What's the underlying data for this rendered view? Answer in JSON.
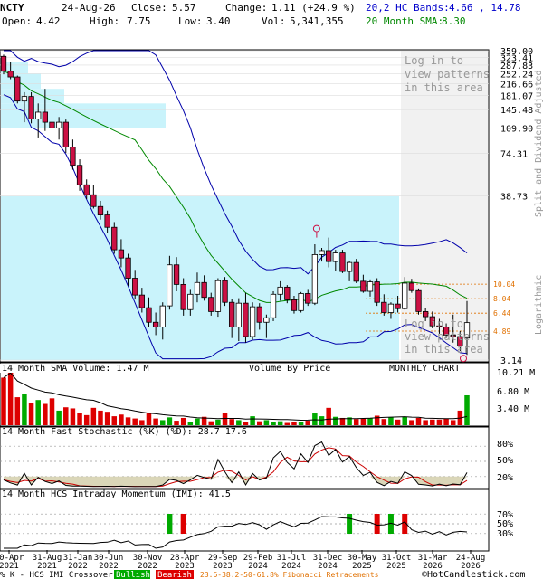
{
  "header": {
    "symbol": "NCTY",
    "date": "24-Aug-26",
    "close_label": "Close:",
    "close": "5.57",
    "change_label": "Change:",
    "change": "1.11 (+24.9 %)",
    "open_label": "Open:",
    "open": "4.42",
    "high_label": "High:",
    "high": "7.75",
    "low_label": "Low:",
    "low": "3.40",
    "vol_label": "Vol:",
    "vol": "5,341,355",
    "bands_label": "20,2 HC Bands:",
    "bands_value": "4.66 , 14.78",
    "sma_label": "20 Month SMA:",
    "sma_value": "8.30"
  },
  "side_label": "Split and Dividend Adjusted",
  "log_label": "Logarithmic",
  "patterns_note": [
    "Log in to",
    "view patterns",
    "in this area"
  ],
  "price_ticks": [
    "359.00",
    "323.41",
    "287.83",
    "252.24",
    "216.66",
    "181.07",
    "145.48",
    "109.90",
    "74.31",
    "38.73",
    "3.14"
  ],
  "fib_labels": [
    "10.04",
    "8.04",
    "6.44",
    "4.89"
  ],
  "volume_panel": {
    "title": "14 Month SMA Volume: 1.47 M",
    "vbp": "Volume By Price",
    "period": "MONTHLY CHART",
    "ticks": [
      "10.21 M",
      "6.80 M",
      "3.40 M"
    ]
  },
  "stoch_panel": {
    "title": "14 Month Fast Stochastic (%K) (%D): 28.7  17.6",
    "ticks": [
      "80%",
      "50%",
      "20%"
    ]
  },
  "imi_panel": {
    "title": "14 Month HCS Intraday Momentum (IMI): 41.5",
    "ticks": [
      "70%",
      "50%",
      "30%"
    ]
  },
  "x_labels": [
    "30-Apr\n2021",
    "31-Aug\n2021",
    "31-Jan\n2022",
    "30-Jun\n2022",
    "30-Nov\n2022",
    "28-Apr\n2023",
    "29-Sep\n2023",
    "29-Feb\n2024",
    "31-Jul\n2024",
    "31-Dec\n2024",
    "30-May\n2025",
    "31-Oct\n2025",
    "31-Mar\n2026",
    "24-Aug\n2026"
  ],
  "footer": {
    "k_text": "% K - HCS IMI Crossover:",
    "bullish": "Bullish",
    "bearish": "Bearish",
    "fib_text": "23.6-38.2-50-61.8% Fibonacci Retracements",
    "brand": "©HotCandlestick.com"
  },
  "colors": {
    "up": "#ffffff",
    "down": "#cc1144",
    "band": "#0000aa",
    "sma": "#008800",
    "vbp": "#c9f3fb",
    "vol_up": "#00aa00",
    "vol_down": "#dd0000",
    "fib": "#e07000"
  },
  "chart_data": {
    "type": "candlestick",
    "y_scale": "log",
    "ylim": [
      3.14,
      359.0
    ],
    "x": [
      "30-Apr-2021",
      "31-Aug-2021",
      "31-Jan-2022",
      "30-Jun-2022",
      "30-Nov-2022",
      "28-Apr-2023",
      "29-Sep-2023",
      "29-Feb-2024",
      "31-Jul-2024",
      "31-Dec-2024",
      "30-May-2025",
      "31-Oct-2025",
      "31-Mar-2026",
      "24-Aug-2026"
    ],
    "candles": [
      [
        329,
        338,
        250,
        262
      ],
      [
        262,
        300,
        232,
        240
      ],
      [
        240,
        245,
        160,
        166
      ],
      [
        166,
        190,
        120,
        178
      ],
      [
        178,
        190,
        118,
        126
      ],
      [
        126,
        160,
        95,
        140
      ],
      [
        140,
        200,
        105,
        120
      ],
      [
        120,
        175,
        98,
        110
      ],
      [
        110,
        130,
        92,
        120
      ],
      [
        120,
        125,
        75,
        82
      ],
      [
        82,
        92,
        58,
        62
      ],
      [
        62,
        68,
        42,
        46
      ],
      [
        46,
        50,
        37,
        39.5
      ],
      [
        39.5,
        46,
        32,
        33
      ],
      [
        33,
        36,
        27,
        29
      ],
      [
        29,
        31,
        22,
        24
      ],
      [
        24,
        26,
        16,
        17
      ],
      [
        17,
        20,
        13,
        15
      ],
      [
        15,
        16,
        9.8,
        11
      ],
      [
        11,
        12.5,
        8,
        8.5
      ],
      [
        8.5,
        9.5,
        6.5,
        7
      ],
      [
        7,
        8.2,
        5.2,
        5.6
      ],
      [
        5.6,
        6.5,
        4.6,
        5.2
      ],
      [
        5.2,
        7.6,
        4.3,
        7.2
      ],
      [
        7.2,
        15.5,
        6.8,
        13.5
      ],
      [
        13.5,
        15.2,
        9,
        10
      ],
      [
        10,
        11,
        6.2,
        6.8
      ],
      [
        6.8,
        9.2,
        6.2,
        8.6
      ],
      [
        8.6,
        12,
        7.6,
        10.3
      ],
      [
        10.3,
        11.5,
        7.8,
        8.2
      ],
      [
        8.2,
        8.8,
        6.2,
        6.6
      ],
      [
        6.6,
        11,
        6.1,
        10.6
      ],
      [
        10.6,
        11.2,
        7.2,
        7.6
      ],
      [
        7.6,
        8,
        4.4,
        5.2
      ],
      [
        5.2,
        8.1,
        4.2,
        7.5
      ],
      [
        7.5,
        8.8,
        4.1,
        4.5
      ],
      [
        4.5,
        7.6,
        4.3,
        7.1
      ],
      [
        7.1,
        7.5,
        5,
        5.6
      ],
      [
        5.6,
        6.3,
        4.4,
        6
      ],
      [
        6,
        9,
        5.7,
        8.6
      ],
      [
        8.6,
        10.5,
        7.8,
        9.6
      ],
      [
        9.6,
        9.9,
        7.5,
        7.9
      ],
      [
        7.9,
        8.4,
        6.4,
        6.7
      ],
      [
        6.7,
        8.9,
        6.5,
        8.7
      ],
      [
        8.7,
        9.2,
        7.2,
        7.5
      ],
      [
        7.5,
        18.5,
        7.3,
        15.8
      ],
      [
        15.8,
        17.5,
        14.2,
        16.8
      ],
      [
        16.8,
        20.5,
        13,
        14.2
      ],
      [
        14.2,
        17,
        12.3,
        16.2
      ],
      [
        16.2,
        17,
        11.9,
        12.2
      ],
      [
        12.2,
        14.4,
        10.5,
        14
      ],
      [
        14,
        14.8,
        10.2,
        10.5
      ],
      [
        10.5,
        11.6,
        8.8,
        9
      ],
      [
        9,
        10.8,
        8.3,
        10.4
      ],
      [
        10.4,
        11,
        7.2,
        7.6
      ],
      [
        7.6,
        8.6,
        6.2,
        6.5
      ],
      [
        6.5,
        7.6,
        5.9,
        7.4
      ],
      [
        7.4,
        8.4,
        6.5,
        6.9
      ],
      [
        6.9,
        11.2,
        6.8,
        10.2
      ],
      [
        10.2,
        10.9,
        8.8,
        9.1
      ],
      [
        9.1,
        9.4,
        6.3,
        6.6
      ],
      [
        6.6,
        7,
        5.7,
        6.1
      ],
      [
        6.1,
        6.6,
        5.1,
        5.3
      ],
      [
        5.3,
        5.9,
        4.7,
        5.2
      ],
      [
        5.2,
        5.5,
        4.4,
        4.6
      ],
      [
        4.6,
        6.3,
        4.1,
        4.5
      ],
      [
        4.5,
        4.9,
        3.6,
        3.9
      ],
      [
        4.4,
        7.75,
        3.4,
        5.57
      ]
    ]
  }
}
